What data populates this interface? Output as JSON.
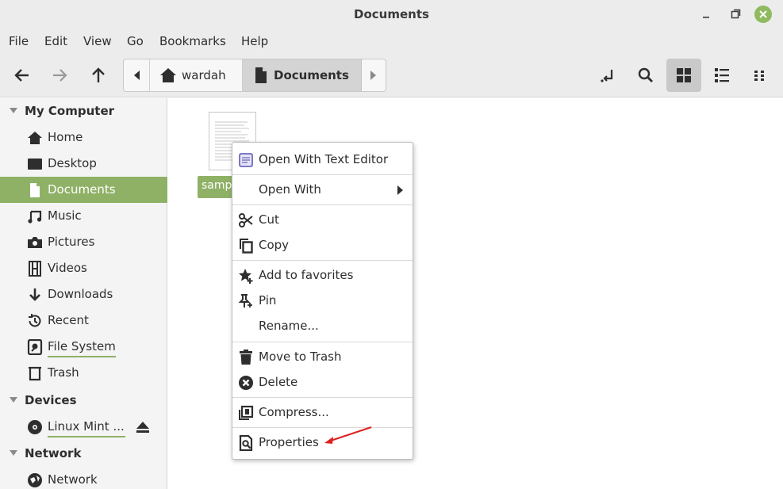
{
  "window": {
    "title": "Documents"
  },
  "menubar": {
    "items": [
      "File",
      "Edit",
      "View",
      "Go",
      "Bookmarks",
      "Help"
    ]
  },
  "toolbar": {
    "back_icon": "arrow-left-icon",
    "forward_icon": "arrow-right-icon",
    "up_icon": "arrow-up-icon",
    "path": [
      {
        "label": "wardah",
        "icon": "home-icon"
      },
      {
        "label": "Documents",
        "icon": "document-icon"
      }
    ],
    "toggle_location_icon": "location-toggle-icon",
    "search_icon": "search-icon",
    "views": [
      "icon-view",
      "list-view",
      "compact-view"
    ]
  },
  "sidebar": {
    "sections": [
      {
        "title": "My Computer",
        "items": [
          {
            "label": "Home",
            "icon": "home-icon"
          },
          {
            "label": "Desktop",
            "icon": "desktop-icon"
          },
          {
            "label": "Documents",
            "icon": "document-icon",
            "selected": true
          },
          {
            "label": "Music",
            "icon": "music-icon"
          },
          {
            "label": "Pictures",
            "icon": "camera-icon"
          },
          {
            "label": "Videos",
            "icon": "film-icon"
          },
          {
            "label": "Downloads",
            "icon": "download-icon"
          },
          {
            "label": "Recent",
            "icon": "history-icon"
          },
          {
            "label": "File System",
            "icon": "harddisk-icon"
          },
          {
            "label": "Trash",
            "icon": "trash-icon"
          }
        ]
      },
      {
        "title": "Devices",
        "items": [
          {
            "label": "Linux Mint ...",
            "icon": "disc-icon",
            "eject": true
          }
        ]
      },
      {
        "title": "Network",
        "items": [
          {
            "label": "Network",
            "icon": "network-icon"
          }
        ]
      }
    ]
  },
  "files": [
    {
      "name": "samp",
      "selected": true
    }
  ],
  "context_menu": {
    "items": [
      {
        "label": "Open With Text Editor",
        "icon": "text-editor-icon"
      },
      {
        "label": "Open With",
        "submenu": true
      },
      {
        "label": "Cut",
        "icon": "scissors-icon"
      },
      {
        "label": "Copy",
        "icon": "copy-icon"
      },
      {
        "label": "Add to favorites",
        "icon": "star-plus-icon"
      },
      {
        "label": "Pin",
        "icon": "pin-icon"
      },
      {
        "label": "Rename..."
      },
      {
        "label": "Move to Trash",
        "icon": "trash-icon"
      },
      {
        "label": "Delete",
        "icon": "delete-icon"
      },
      {
        "label": "Compress...",
        "icon": "compress-icon"
      },
      {
        "label": "Properties",
        "icon": "properties-icon"
      }
    ]
  },
  "colors": {
    "accent": "#8fb166",
    "close_button": "#8fba5e",
    "annotation_arrow": "#e02020"
  }
}
